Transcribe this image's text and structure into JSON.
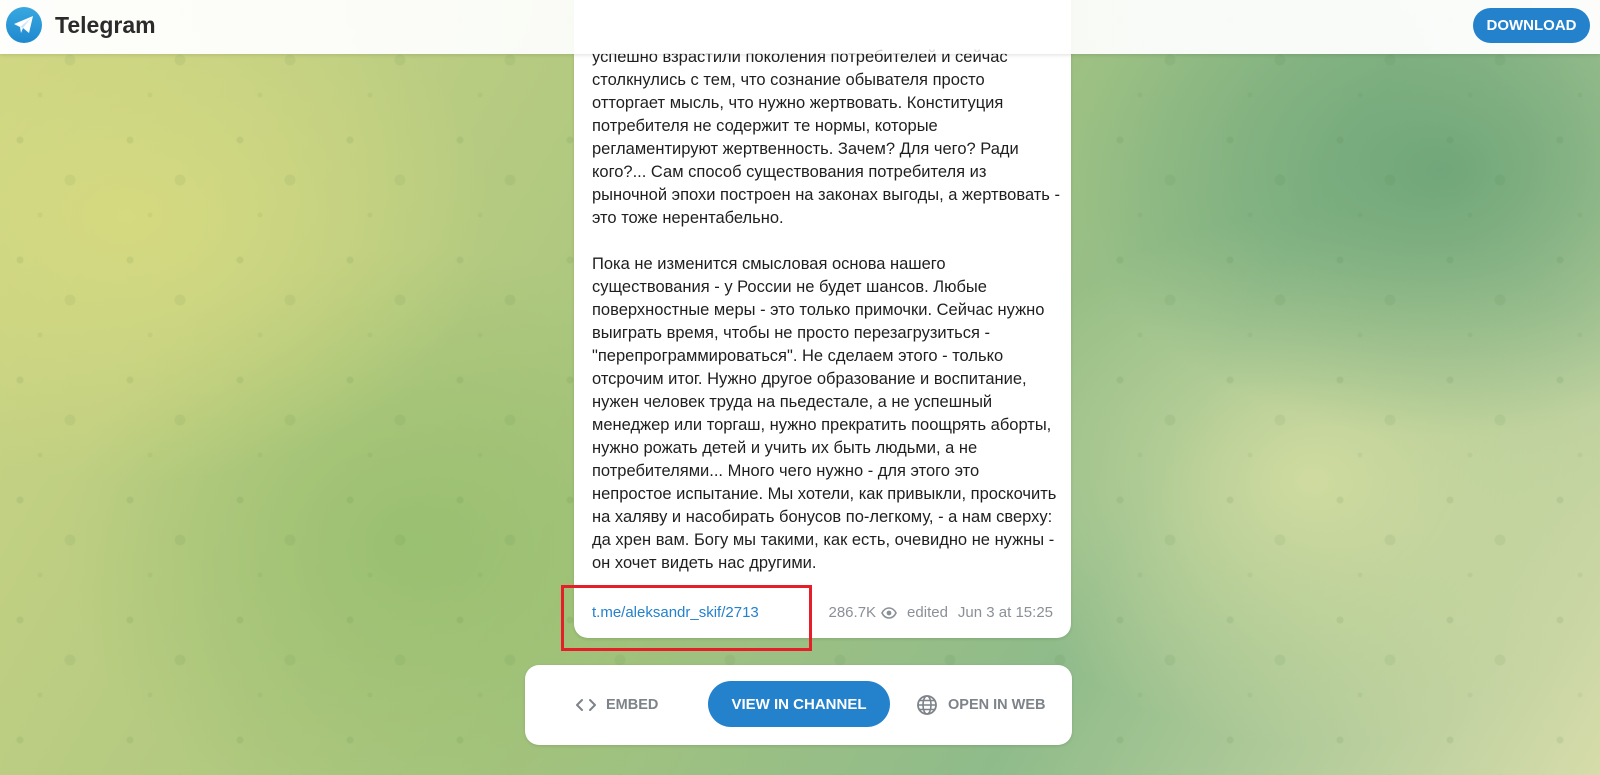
{
  "header": {
    "app_name": "Telegram",
    "download_label": "DOWNLOAD"
  },
  "post": {
    "text": "успешно взрастили поколения потребителей и сейчас столкнулись с тем, что сознание обывателя просто отторгает мысль, что нужно жертвовать. Конституция потребителя не содержит те нормы, которые регламентируют жертвенность. Зачем? Для чего? Ради кого?... Сам способ существования потребителя из рыночной эпохи построен на законах выгоды, а жертвовать - это тоже нерентабельно.\n\nПока не изменится смысловая основа нашего существования - у России не будет шансов. Любые поверхностные меры - это только примочки. Сейчас нужно выиграть время, чтобы не просто перезагрузиться - \"перепрограммироваться\". Не сделаем этого - только отсрочим итог. Нужно другое образование и воспитание, нужен человек труда на пьедестале, а не успешный менеджер или торгаш, нужно прекратить поощрять аборты, нужно рожать детей и учить их быть людьми, а не потребителями... Много чего нужно - для этого это непростое испытание. Мы хотели, как привыкли, проскочить на халяву и насобирать бонусов по-легкому, - а нам сверху: да хрен вам. Богу мы такими, как есть, очевидно не нужны - он хочет видеть нас другими.",
    "link": "t.me/aleksandr_skif/2713",
    "views": "286.7K",
    "edited": "edited",
    "date": "Jun 3 at 15:25"
  },
  "actions": {
    "embed": "EMBED",
    "view_in_channel": "VIEW IN CHANNEL",
    "open_in_web": "OPEN IN WEB"
  },
  "colors": {
    "accent": "#2481cc",
    "highlight": "#e51e2a"
  }
}
